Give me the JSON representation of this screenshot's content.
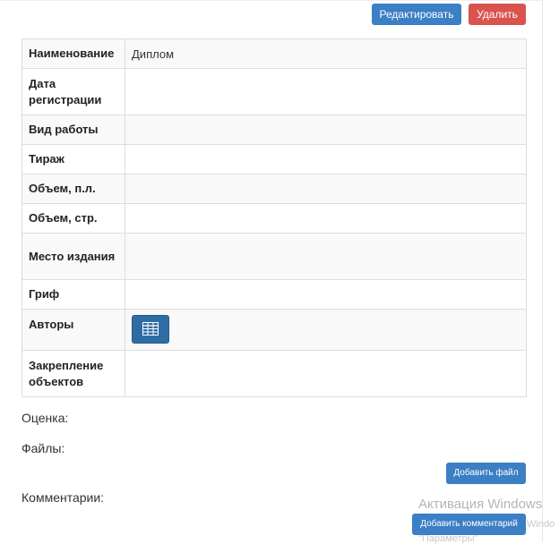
{
  "actions": {
    "edit_label": "Редактировать",
    "delete_label": "Удалить"
  },
  "details": {
    "rows": [
      {
        "label": "Наименование",
        "value": "Диплом"
      },
      {
        "label": "Дата регистрации",
        "value": ""
      },
      {
        "label": "Вид работы",
        "value": ""
      },
      {
        "label": "Тираж",
        "value": ""
      },
      {
        "label": "Объем, п.л.",
        "value": ""
      },
      {
        "label": "Объем, стр.",
        "value": ""
      },
      {
        "label": "Место издания",
        "value": ""
      },
      {
        "label": "Гриф",
        "value": ""
      },
      {
        "label": "Авторы",
        "value": "",
        "icon": "table-grid-icon"
      },
      {
        "label": "Закрепление объектов",
        "value": ""
      }
    ]
  },
  "sections": {
    "rating_label": "Оценка:",
    "files_label": "Файлы:",
    "add_file_label": "Добавить файл",
    "comments_label": "Комментарии:",
    "add_comment_label": "Добавить комментарий"
  },
  "watermark": {
    "title": "Активация Windows",
    "line1": "Windo",
    "line2": "\"Параметры\""
  },
  "colors": {
    "primary": "#3b7fc4",
    "danger": "#d9534f",
    "icon_button": "#2e6da4"
  }
}
